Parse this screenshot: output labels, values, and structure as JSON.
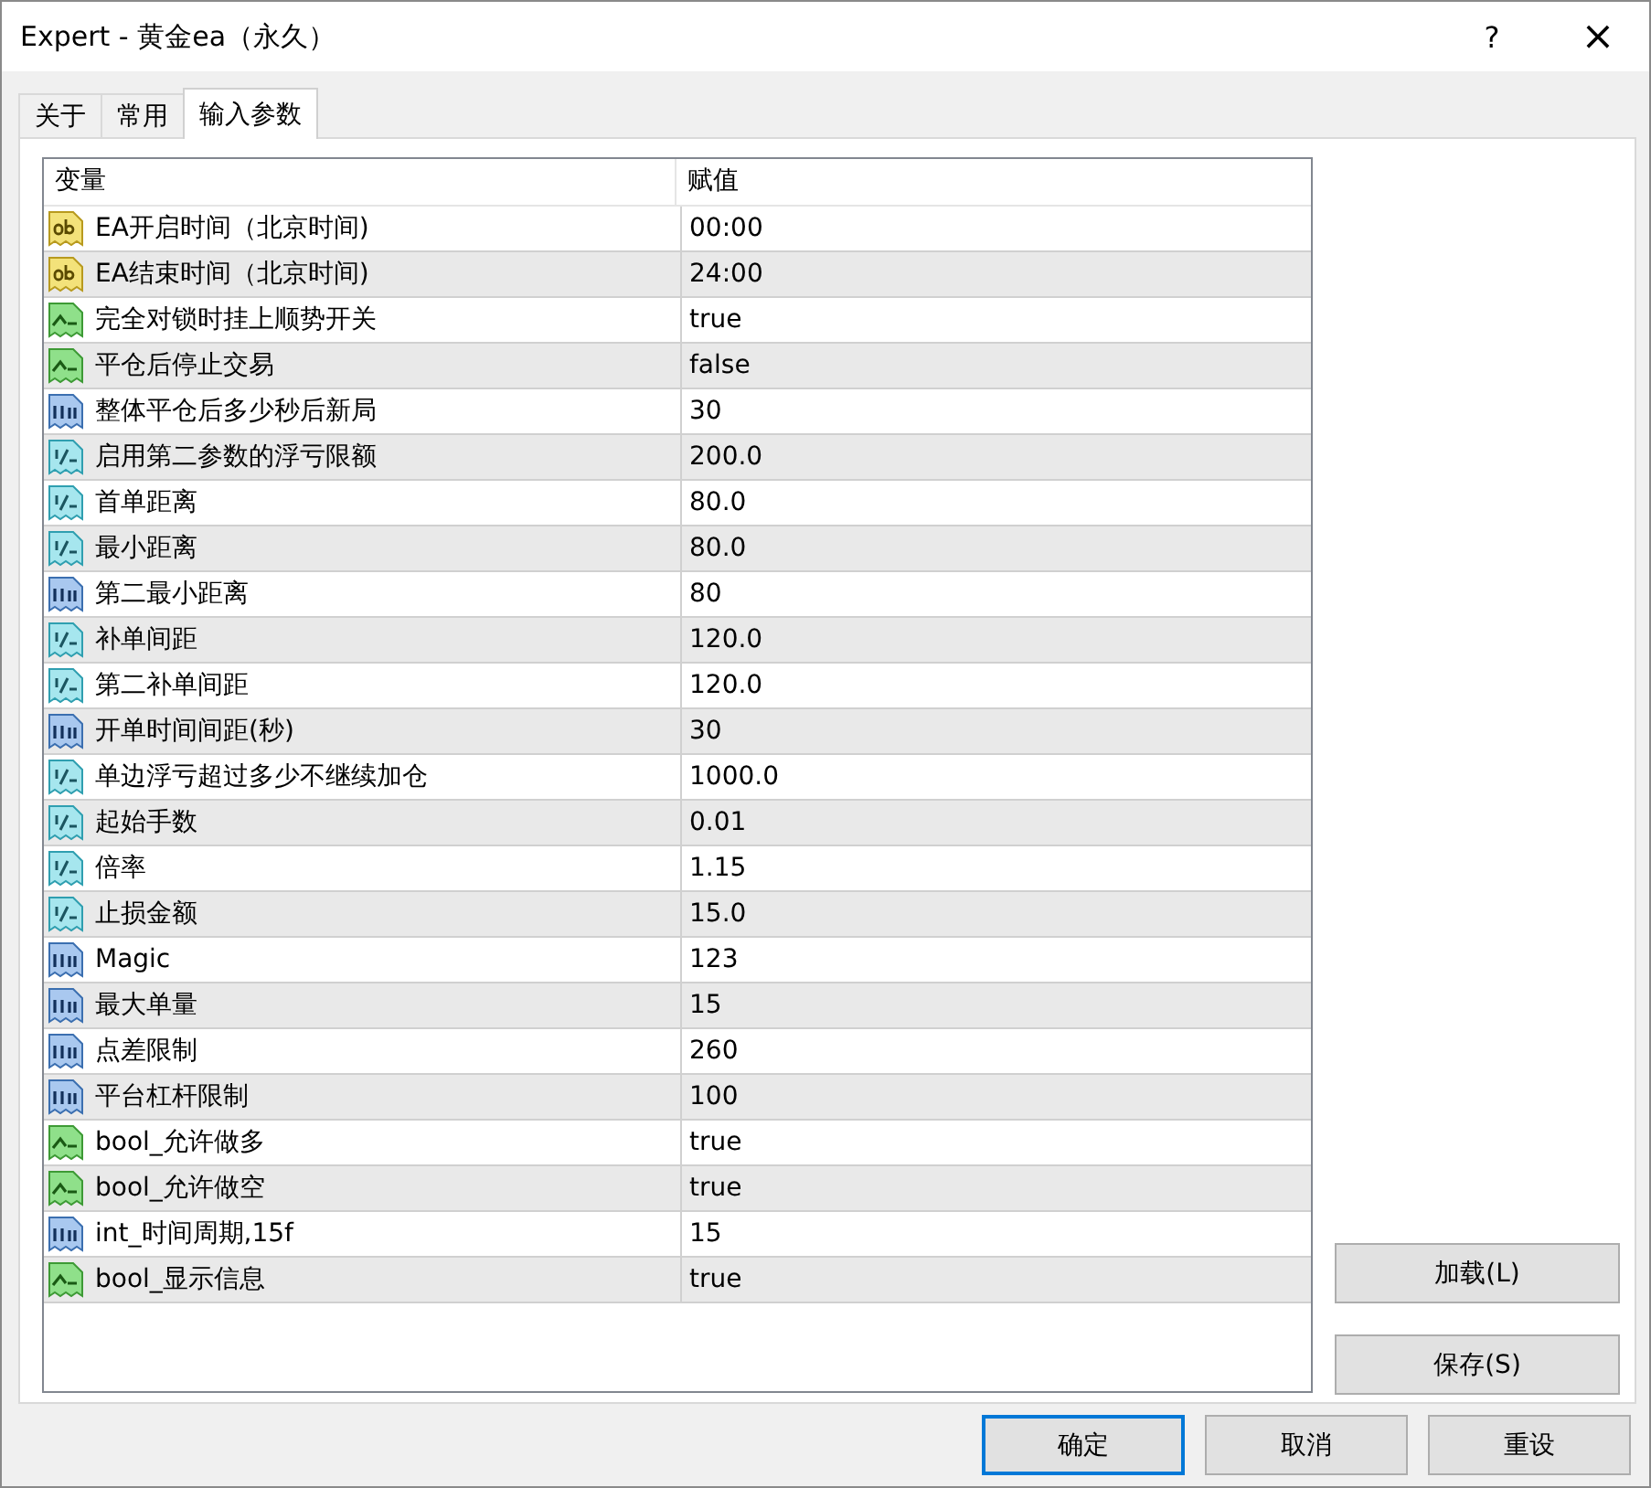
{
  "window": {
    "title": "Expert - 黄金ea（永久）",
    "help": "?",
    "close": "×"
  },
  "tabs": [
    {
      "label": "关于",
      "selected": false
    },
    {
      "label": "常用",
      "selected": false
    },
    {
      "label": "输入参数",
      "selected": true
    }
  ],
  "table": {
    "columns": [
      "变量",
      "赋值"
    ],
    "rows": [
      {
        "kind": "string",
        "name": "EA开启时间（北京时间)",
        "value": "00:00"
      },
      {
        "kind": "string",
        "name": "EA结束时间（北京时间)",
        "value": "24:00"
      },
      {
        "kind": "bool",
        "name": "完全对锁时挂上顺势开关",
        "value": "true"
      },
      {
        "kind": "bool",
        "name": "平仓后停止交易",
        "value": "false"
      },
      {
        "kind": "int",
        "name": "整体平仓后多少秒后新局",
        "value": "30"
      },
      {
        "kind": "double",
        "name": "启用第二参数的浮亏限额",
        "value": "200.0"
      },
      {
        "kind": "double",
        "name": "首单距离",
        "value": "80.0"
      },
      {
        "kind": "double",
        "name": "最小距离",
        "value": "80.0"
      },
      {
        "kind": "int",
        "name": "第二最小距离",
        "value": "80"
      },
      {
        "kind": "double",
        "name": "补单间距",
        "value": "120.0"
      },
      {
        "kind": "double",
        "name": "第二补单间距",
        "value": "120.0"
      },
      {
        "kind": "int",
        "name": "开单时间间距(秒)",
        "value": "30"
      },
      {
        "kind": "double",
        "name": "单边浮亏超过多少不继续加仓",
        "value": "1000.0"
      },
      {
        "kind": "double",
        "name": "起始手数",
        "value": "0.01"
      },
      {
        "kind": "double",
        "name": "倍率",
        "value": "1.15"
      },
      {
        "kind": "double",
        "name": "止损金额",
        "value": "15.0"
      },
      {
        "kind": "int",
        "name": "Magic",
        "value": "123"
      },
      {
        "kind": "int",
        "name": "最大单量",
        "value": "15"
      },
      {
        "kind": "int",
        "name": "点差限制",
        "value": "260"
      },
      {
        "kind": "int",
        "name": "平台杠杆限制",
        "value": "100"
      },
      {
        "kind": "bool",
        "name": "bool_允许做多",
        "value": "true"
      },
      {
        "kind": "bool",
        "name": "bool_允许做空",
        "value": "true"
      },
      {
        "kind": "int",
        "name": "int_时间周期,15f",
        "value": "15"
      },
      {
        "kind": "bool",
        "name": "bool_显示信息",
        "value": "true"
      }
    ]
  },
  "side_buttons": [
    "加载(L)",
    "保存(S)"
  ],
  "buttons": [
    {
      "label": "确定",
      "focused": true
    },
    {
      "label": "取消",
      "focused": false
    },
    {
      "label": "重设",
      "focused": false
    }
  ]
}
